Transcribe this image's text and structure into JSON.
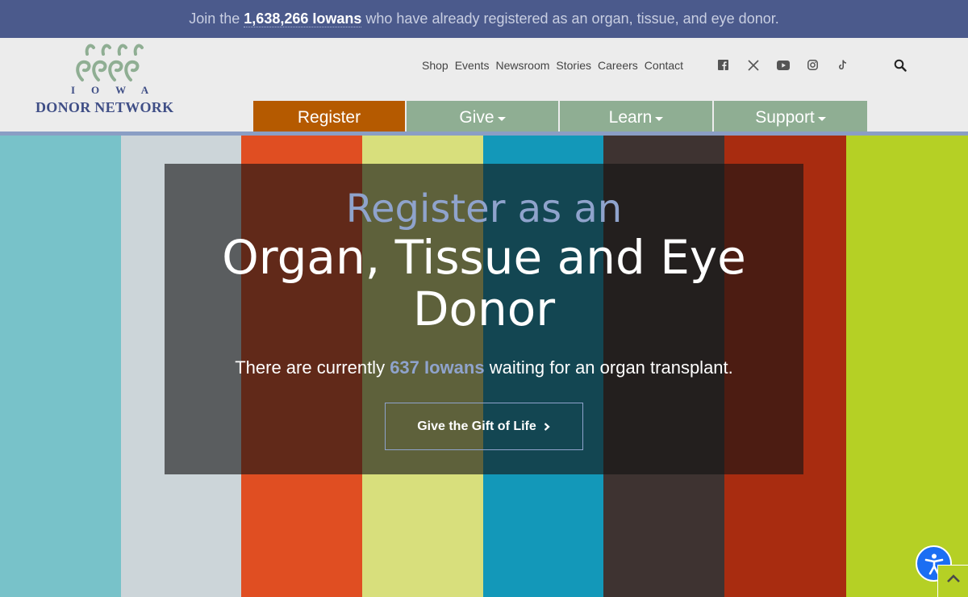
{
  "announcement": {
    "prefix": "Join the ",
    "count": "1,638,266 Iowans",
    "suffix": " who have already registered as an organ, tissue, and eye donor."
  },
  "logo": {
    "line1": "IOWA",
    "line2": "DONOR NETWORK",
    "color": "#3f4e86",
    "loops_color": "#8fae93"
  },
  "utility_nav": [
    "Shop",
    "Events",
    "Newsroom",
    "Stories",
    "Careers",
    "Contact"
  ],
  "social_icons": [
    "facebook-icon",
    "x-twitter-icon",
    "youtube-icon",
    "instagram-icon",
    "tiktok-icon"
  ],
  "main_nav": {
    "register": "Register",
    "give": "Give",
    "learn": "Learn",
    "support": "Support"
  },
  "colors": {
    "topbar": "#4b5a8c",
    "register_btn": "#b55a00",
    "nav_btn": "#8fae93",
    "accent": "#8fa3cc"
  },
  "hero": {
    "stripes": [
      "#78c2c9",
      "#ccd5d9",
      "#e04e22",
      "#d8df7c",
      "#1398b9",
      "#3e3331",
      "#a82c10",
      "#b5d025"
    ],
    "heading_pre": "Register as an",
    "heading_main": "Organ, Tissue and Eye Donor",
    "sub_prefix": "There are currently ",
    "sub_highlight": "637 Iowans",
    "sub_suffix": " waiting for an organ transplant.",
    "cta_label": "Give the Gift of Life"
  }
}
